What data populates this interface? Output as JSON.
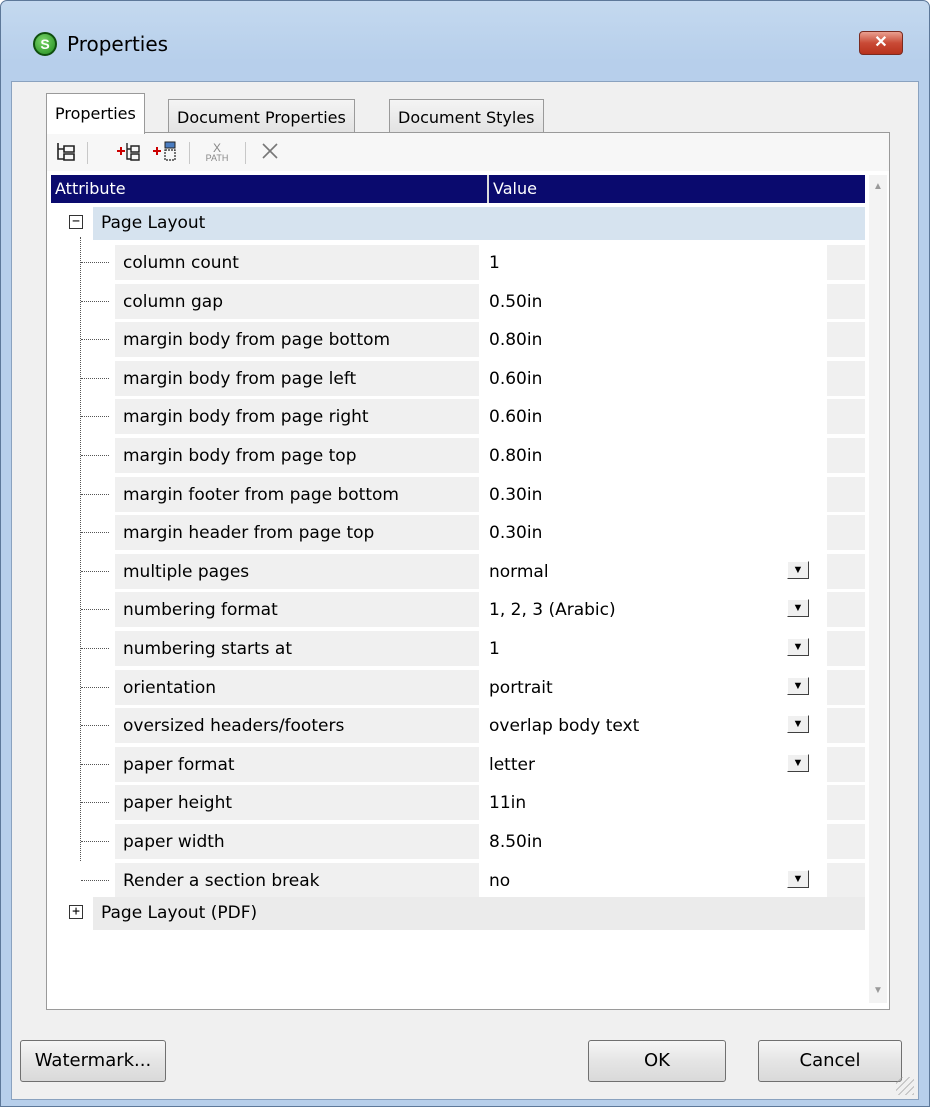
{
  "window": {
    "title": "Properties",
    "close_glyph": "✕"
  },
  "tabs": [
    {
      "label": "Properties",
      "active": true
    },
    {
      "label": "Document Properties",
      "active": false
    },
    {
      "label": "Document Styles",
      "active": false
    }
  ],
  "toolbar": {
    "buttons": [
      {
        "icon": "tree-view-icon"
      },
      {
        "icon": "insert-attribute-icon"
      },
      {
        "icon": "append-attribute-icon"
      },
      {
        "icon": "xpath-icon",
        "label": "PATH"
      },
      {
        "icon": "delete-icon"
      }
    ]
  },
  "grid": {
    "header": {
      "attribute": "Attribute",
      "value": "Value"
    },
    "groups": [
      {
        "label": "Page Layout",
        "expanded": true,
        "expander_glyph": "−",
        "rows": [
          {
            "attribute": "column count",
            "value": "1",
            "dropdown": false
          },
          {
            "attribute": "column gap",
            "value": "0.50in",
            "dropdown": false
          },
          {
            "attribute": "margin body from page bottom",
            "value": "0.80in",
            "dropdown": false
          },
          {
            "attribute": "margin body from page left",
            "value": "0.60in",
            "dropdown": false
          },
          {
            "attribute": "margin body from page right",
            "value": "0.60in",
            "dropdown": false
          },
          {
            "attribute": "margin body from page top",
            "value": "0.80in",
            "dropdown": false
          },
          {
            "attribute": "margin footer from page bottom",
            "value": "0.30in",
            "dropdown": false
          },
          {
            "attribute": "margin header from page top",
            "value": "0.30in",
            "dropdown": false
          },
          {
            "attribute": "multiple pages",
            "value": "normal",
            "dropdown": true
          },
          {
            "attribute": "numbering format",
            "value": "1, 2, 3 (Arabic)",
            "dropdown": true
          },
          {
            "attribute": "numbering starts at",
            "value": "1",
            "dropdown": true
          },
          {
            "attribute": "orientation",
            "value": "portrait",
            "dropdown": true
          },
          {
            "attribute": "oversized headers/footers",
            "value": "overlap body text",
            "dropdown": true
          },
          {
            "attribute": "paper format",
            "value": "letter",
            "dropdown": true
          },
          {
            "attribute": "paper height",
            "value": "11in",
            "dropdown": false
          },
          {
            "attribute": "paper width",
            "value": "8.50in",
            "dropdown": false
          },
          {
            "attribute": "Render a section break",
            "value": "no",
            "dropdown": true
          }
        ]
      },
      {
        "label": "Page Layout (PDF)",
        "expanded": false,
        "expander_glyph": "+",
        "rows": []
      }
    ]
  },
  "footer": {
    "watermark_label": "Watermark...",
    "ok_label": "OK",
    "cancel_label": "Cancel"
  }
}
